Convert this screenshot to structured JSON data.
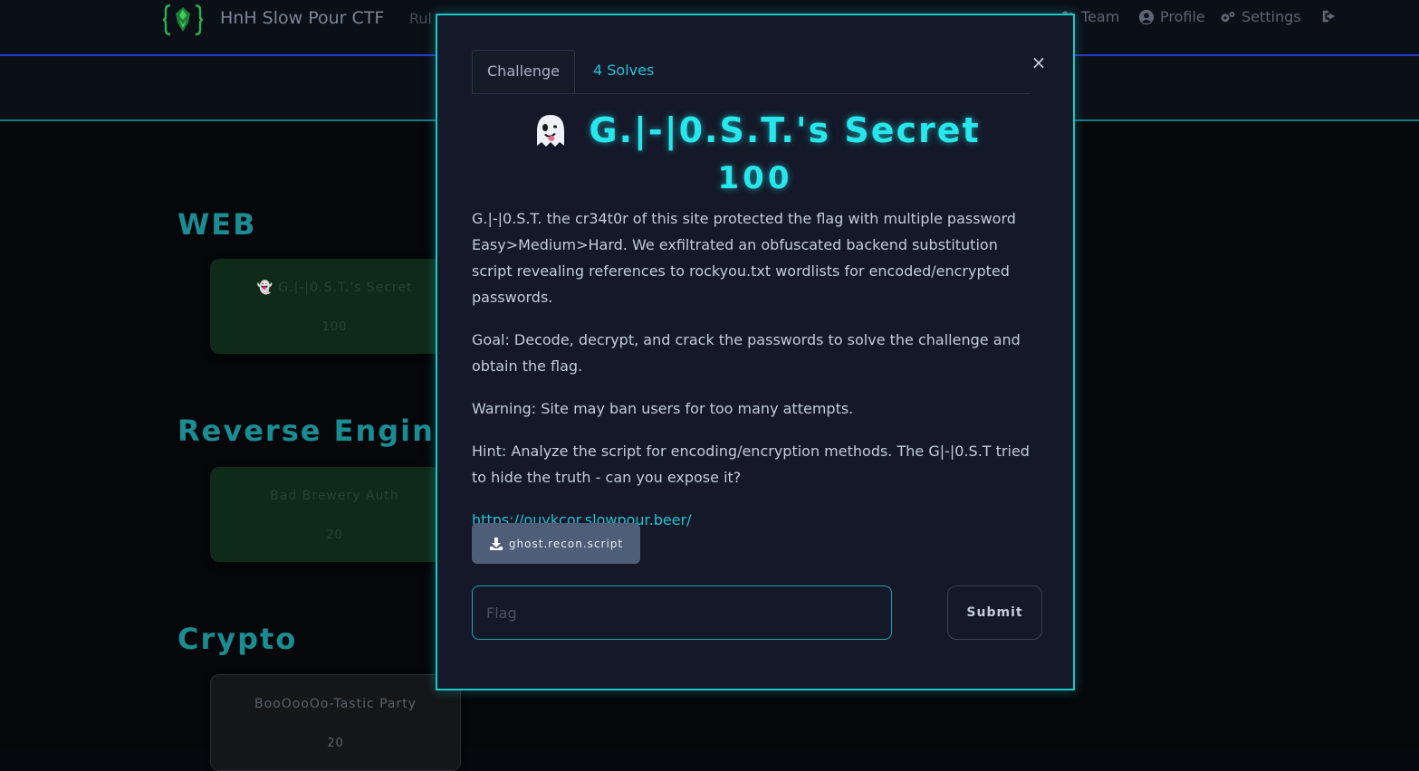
{
  "navbar": {
    "brand": "HnH Slow Pour CTF",
    "rules_partial": "Rul",
    "team": "Team",
    "profile": "Profile",
    "settings": "Settings"
  },
  "categories": [
    {
      "title": "WEB",
      "challenge": {
        "name": "👻 G.|-|0.S.T.'s Secret",
        "value": "100"
      }
    },
    {
      "title": "Reverse Engin",
      "challenge": {
        "name": "Bad Brewery Auth",
        "value": "20"
      }
    },
    {
      "title": "Crypto",
      "challenge": {
        "name": "BooOooOo-Tastic Party",
        "value": "20"
      }
    }
  ],
  "modal": {
    "tab_challenge": "Challenge",
    "tab_solves": "4 Solves",
    "close": "×",
    "title": "G.|-|0.S.T.'s Secret",
    "points": "100",
    "description": [
      "G.|-|0.S.T. the cr34t0r of this site protected the flag with multiple password Easy>Medium>Hard. We exfiltrated an obfuscated backend substitution script revealing references to rockyou.txt wordlists for encoded/encrypted passwords.",
      "Goal: Decode, decrypt, and crack the passwords to solve the challenge and obtain the flag.",
      "Warning: Site may ban users for too many attempts.",
      "Hint: Analyze the script for encoding/encryption methods. The G|-|0.S.T tried to hide the truth - can you expose it?"
    ],
    "link": "https://ouykcor.slowpour.beer/",
    "file": "ghost.recon.script",
    "flag_placeholder": "Flag",
    "submit": "Submit"
  },
  "colors": {
    "accent": "#27e6ec",
    "modal_border": "#19c7c7",
    "link": "#1fc4d4",
    "category_title": "#1a8c92"
  }
}
